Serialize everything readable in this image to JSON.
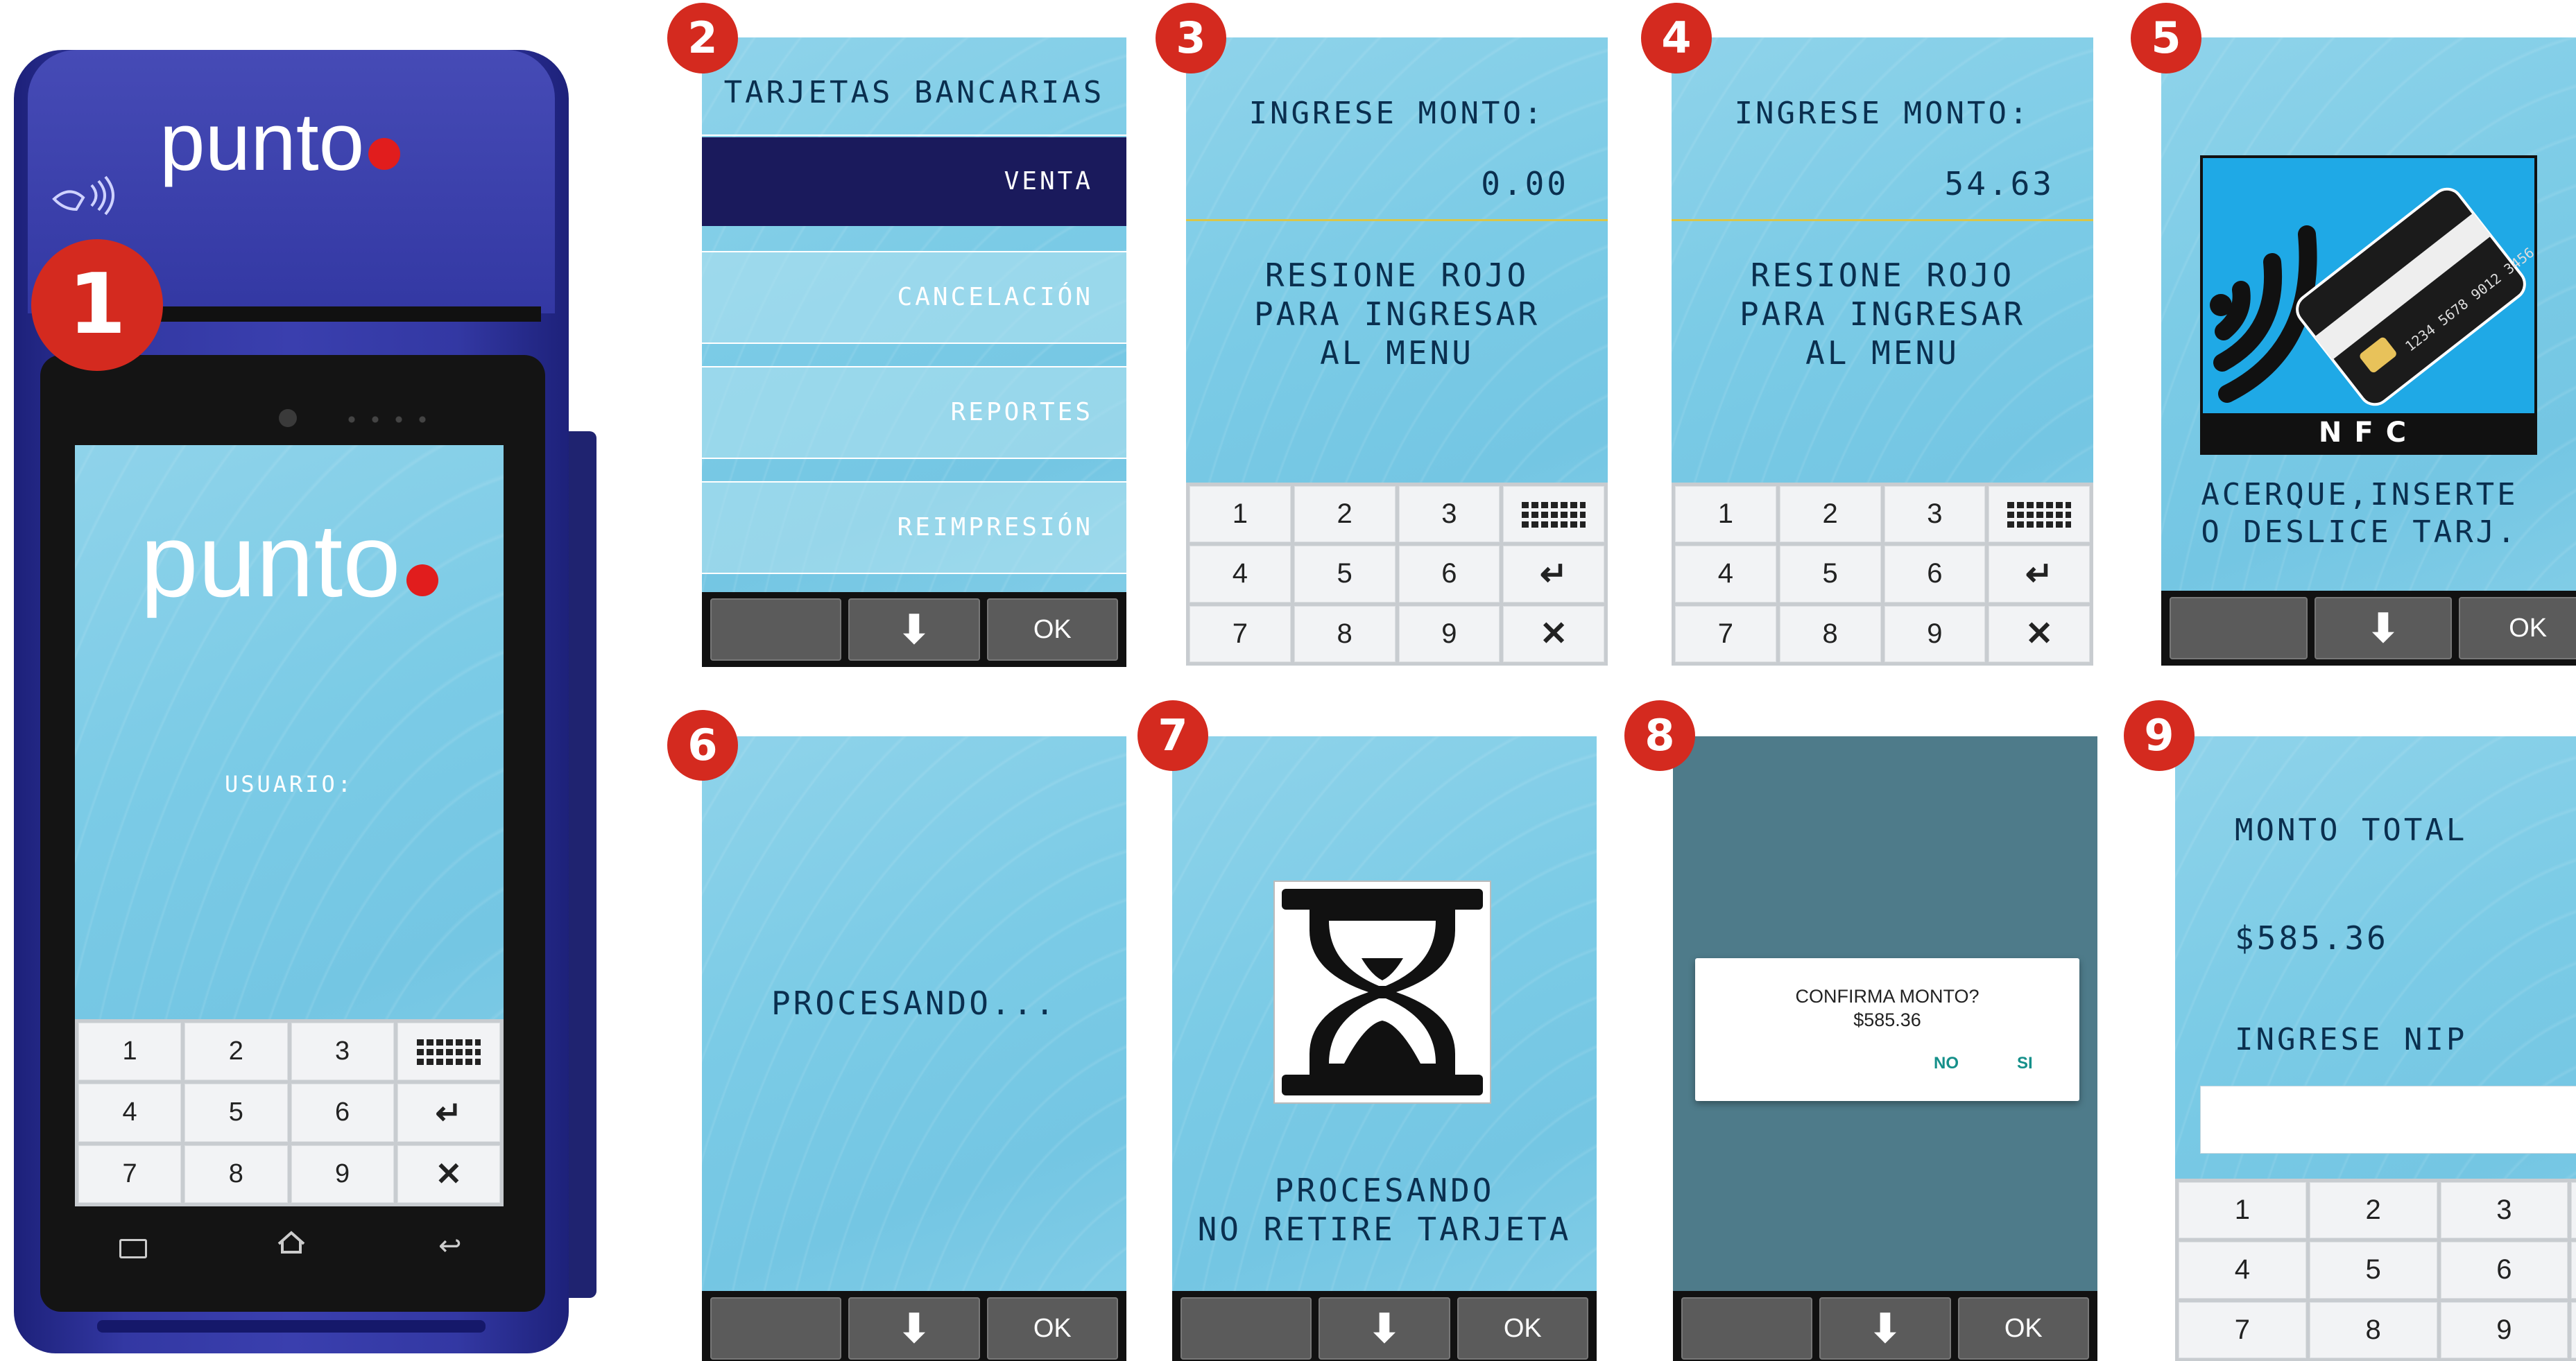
{
  "device": {
    "brand": "punto",
    "screen_logo": "punto",
    "screen_prompt": "USUARIO:",
    "nav_icons": [
      "menu-icon",
      "home-icon",
      "back-icon"
    ]
  },
  "keypad": {
    "keys": [
      "1",
      "2",
      "3",
      "keyboard",
      "4",
      "5",
      "6",
      "enter",
      "7",
      "8",
      "9",
      "cancel"
    ]
  },
  "steps": {
    "s1": {
      "badge": "1"
    },
    "s2": {
      "badge": "2",
      "title": "TARJETAS BANCARIAS",
      "items": [
        "VENTA",
        "CANCELACIÓN",
        "REPORTES",
        "REIMPRESIÓN"
      ],
      "ok": "OK"
    },
    "s3": {
      "badge": "3",
      "label": "INGRESE MONTO:",
      "amount": "0.00",
      "hint1": "RESIONE ROJO",
      "hint2": "PARA INGRESAR",
      "hint3": "AL MENU"
    },
    "s4": {
      "badge": "4",
      "label": "INGRESE MONTO:",
      "amount": "54.63",
      "hint1": "RESIONE ROJO",
      "hint2": "PARA INGRESAR",
      "hint3": "AL MENU"
    },
    "s5": {
      "badge": "5",
      "nfc": "NFC",
      "card_number": "1234 5678 9012 3456",
      "msg1": "ACERQUE,INSERTE",
      "msg2": "O DESLICE TARJ.",
      "ok": "OK"
    },
    "s6": {
      "badge": "6",
      "msg": "PROCESANDO...",
      "ok": "OK"
    },
    "s7": {
      "badge": "7",
      "msg1": "PROCESANDO",
      "msg2": "NO RETIRE TARJETA",
      "ok": "OK"
    },
    "s8": {
      "badge": "8",
      "dialog_title": "CONFIRMA MONTO?",
      "dialog_amount": "$585.36",
      "no": "NO",
      "si": "SI",
      "ok": "OK"
    },
    "s9": {
      "badge": "9",
      "label1": "MONTO TOTAL",
      "amount": "$585.36",
      "label2": "INGRESE NIP",
      "nip_value": ""
    }
  },
  "colors": {
    "badge": "#d42a1f",
    "device_body": "#2b2f8f",
    "menu_selected": "#1a1a5c",
    "screen": "#7bcbe6"
  }
}
